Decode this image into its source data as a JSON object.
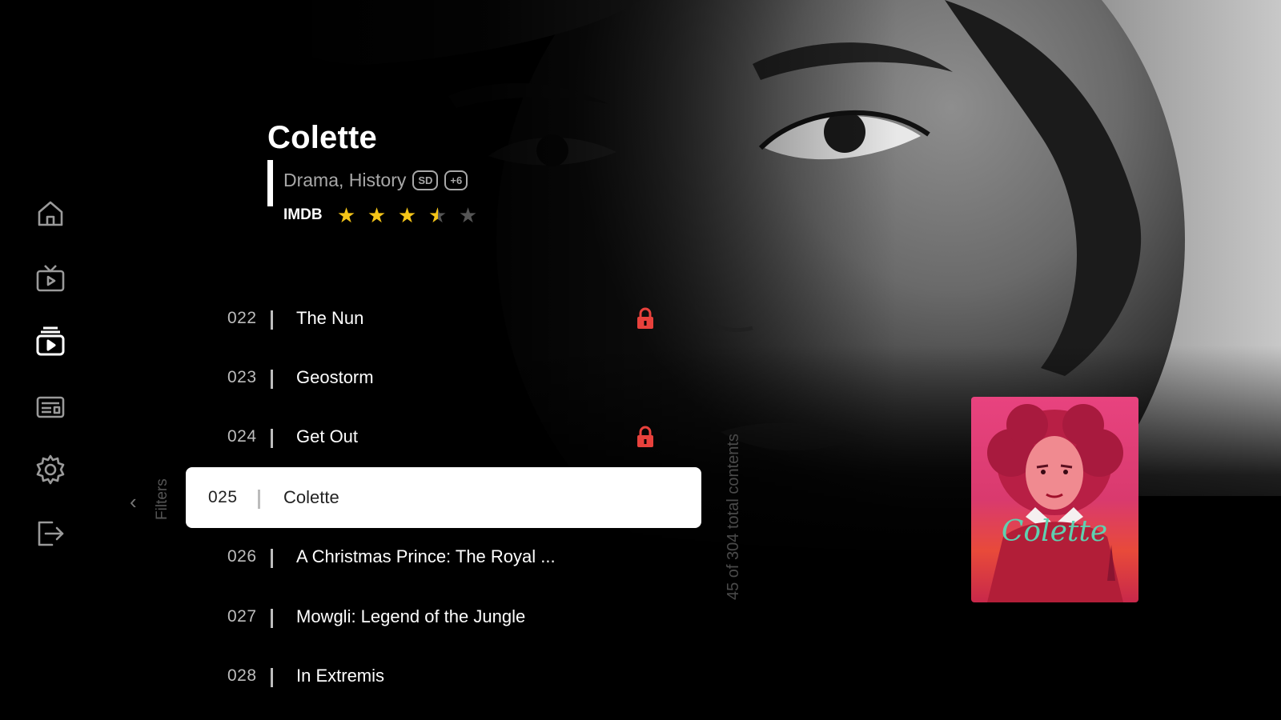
{
  "hero": {
    "title": "Colette",
    "genres": "Drama, History",
    "tags": [
      "SD",
      "+6"
    ],
    "rating_label": "IMDB",
    "rating_stars": 3.5,
    "rating_max": 5
  },
  "sidebar": {
    "items": [
      {
        "name": "home-icon"
      },
      {
        "name": "live-tv-icon"
      },
      {
        "name": "movies-icon",
        "active": true
      },
      {
        "name": "radio-icon"
      },
      {
        "name": "settings-icon"
      },
      {
        "name": "logout-icon"
      }
    ]
  },
  "list": {
    "items": [
      {
        "num": "022",
        "title": "The Nun",
        "locked": true
      },
      {
        "num": "023",
        "title": "Geostorm",
        "locked": false
      },
      {
        "num": "024",
        "title": "Get Out",
        "locked": true
      },
      {
        "num": "025",
        "title": "Colette",
        "locked": false,
        "selected": true
      },
      {
        "num": "026",
        "title": "A Christmas Prince: The Royal ...",
        "locked": false
      },
      {
        "num": "027",
        "title": "Mowgli: Legend of the Jungle",
        "locked": false
      },
      {
        "num": "028",
        "title": "In Extremis",
        "locked": false
      }
    ]
  },
  "filters": {
    "label": "Filters"
  },
  "count": {
    "text": "45 of 304 total contents"
  },
  "poster": {
    "script_title": "Colette"
  },
  "colors": {
    "accent_star": "#f5c518",
    "lock": "#e8413c",
    "poster_pink": "#e8437f"
  }
}
